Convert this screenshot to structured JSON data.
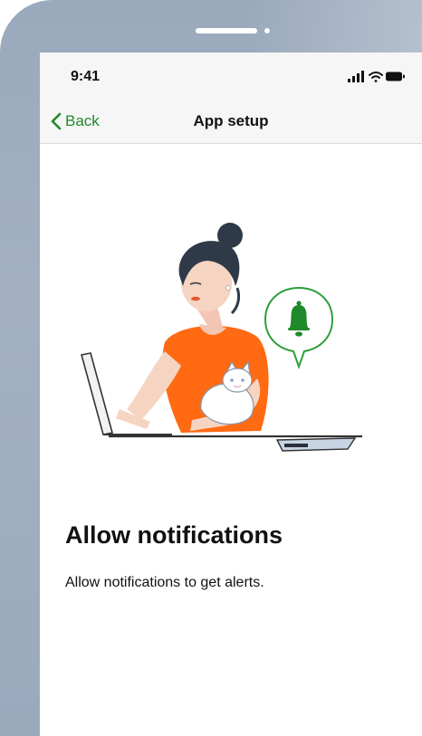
{
  "status_bar": {
    "time": "9:41"
  },
  "nav": {
    "back_label": "Back",
    "title": "App setup"
  },
  "content": {
    "title": "Allow notifications",
    "body": "Allow notifications to get alerts."
  },
  "colors": {
    "accent": "#1f8a2b",
    "shirt": "#ff6a13",
    "bezel": "#9aa9bc"
  },
  "icons": [
    "chevron-left-icon",
    "signal-icon",
    "wifi-icon",
    "battery-icon",
    "bell-icon"
  ]
}
